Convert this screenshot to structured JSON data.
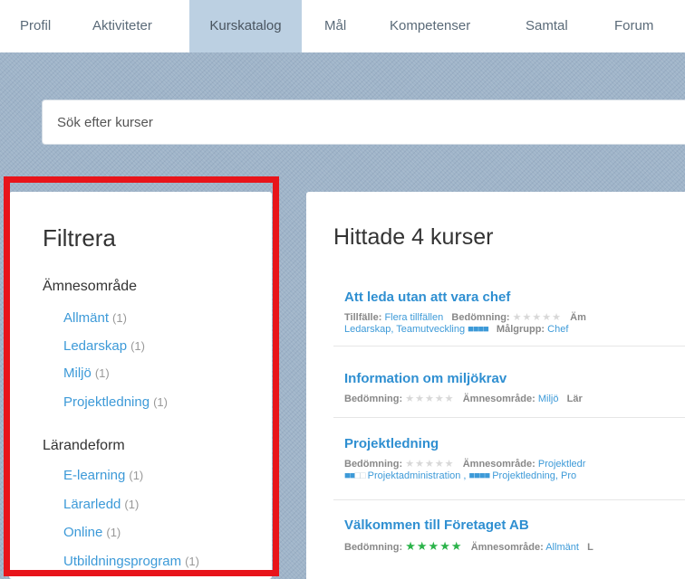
{
  "nav": {
    "tabs": [
      {
        "label": "Profil"
      },
      {
        "label": "Aktiviteter"
      },
      {
        "label": "Kurskatalog"
      },
      {
        "label": "Mål"
      },
      {
        "label": "Kompetenser"
      },
      {
        "label": "Samtal"
      },
      {
        "label": "Forum"
      }
    ],
    "active_index": 2
  },
  "search": {
    "placeholder": "Sök efter kurser"
  },
  "filter": {
    "title": "Filtrera",
    "groups": [
      {
        "label": "Ämnesområde",
        "items": [
          {
            "label": "Allmänt",
            "count": "(1)"
          },
          {
            "label": "Ledarskap",
            "count": "(1)"
          },
          {
            "label": "Miljö",
            "count": "(1)"
          },
          {
            "label": "Projektledning",
            "count": "(1)"
          }
        ]
      },
      {
        "label": "Lärandeform",
        "items": [
          {
            "label": "E-learning",
            "count": "(1)"
          },
          {
            "label": "Lärarledd",
            "count": "(1)"
          },
          {
            "label": "Online",
            "count": "(1)"
          },
          {
            "label": "Utbildningsprogram",
            "count": "(1)"
          }
        ]
      }
    ]
  },
  "results": {
    "heading": "Hittade 4 kurser",
    "courses": [
      {
        "title": "Att leda utan att vara chef",
        "line1": {
          "k1": "Tillfälle:",
          "v1": "Flera tillfällen",
          "k2": "Bedömning:",
          "stars": "★★★★★",
          "k3": "Äm"
        },
        "line2": {
          "v1": "Ledarskap, Teamutveckling",
          "dots": "■■■■",
          "k1": "Målgrupp:",
          "v2": "Chef"
        }
      },
      {
        "title": "Information om miljökrav",
        "line1": {
          "k1": "Bedömning:",
          "stars": "★★★★★",
          "k2": "Ämnesområde:",
          "v1": "Miljö",
          "k3": "Lär"
        }
      },
      {
        "title": "Projektledning",
        "line1": {
          "k1": "Bedömning:",
          "stars": "★★★★★",
          "k2": "Ämnesområde:",
          "v1": "Projektledr"
        },
        "line2": {
          "dots_on": "■■",
          "dots_off": "□□",
          "v1": "Projektadministration ,",
          "dots2": "■■■■",
          "v2": "Projektledning, Pro"
        }
      },
      {
        "title": "Välkommen till Företaget AB",
        "line1": {
          "k1": "Bedömning:",
          "stars": "★★★★★",
          "k2": "Ämnesområde:",
          "v1": "Allmänt",
          "k3": "L"
        }
      }
    ]
  },
  "colors": {
    "accent": "#3d9ad8",
    "highlight_box": "#e8141a",
    "active_tab": "#bcd0e2",
    "rating_green": "#2bb34a"
  }
}
